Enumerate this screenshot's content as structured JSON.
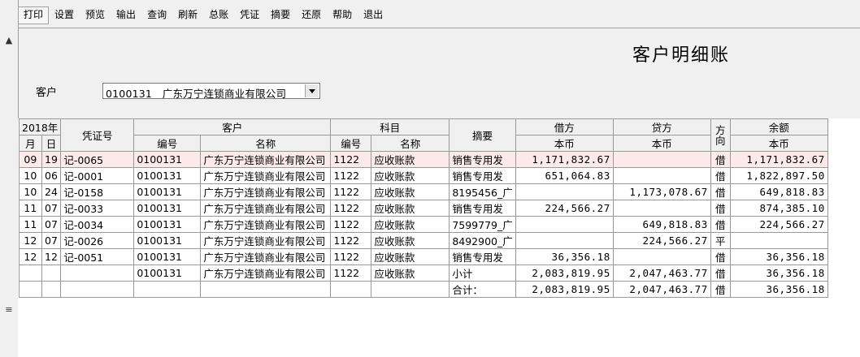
{
  "toolbar": [
    "打印",
    "设置",
    "预览",
    "输出",
    "查询",
    "刷新",
    "总账",
    "凭证",
    "摘要",
    "还原",
    "帮助",
    "退出"
  ],
  "title": "客户明细账",
  "filter": {
    "label": "客户",
    "value": "0100131　广东万宁连锁商业有限公司"
  },
  "header": {
    "year": "2018年",
    "month": "月",
    "day": "日",
    "voucher": "凭证号",
    "customer": "客户",
    "code": "编号",
    "name": "名称",
    "subject": "科目",
    "summary": "摘要",
    "debit": "借方",
    "credit": "贷方",
    "direction": "方向",
    "balance": "余额",
    "currency": "本币"
  },
  "rows": [
    {
      "m": "09",
      "d": "19",
      "v": "记-0065",
      "cc": "0100131",
      "cn": "广东万宁连锁商业有限公司",
      "sc": "1122",
      "sn": "应收账款",
      "s": "销售专用发",
      "dr": "1,171,832.67",
      "cr": "",
      "dir": "借",
      "bal": "1,171,832.67"
    },
    {
      "m": "10",
      "d": "06",
      "v": "记-0001",
      "cc": "0100131",
      "cn": "广东万宁连锁商业有限公司",
      "sc": "1122",
      "sn": "应收账款",
      "s": "销售专用发",
      "dr": "651,064.83",
      "cr": "",
      "dir": "借",
      "bal": "1,822,897.50"
    },
    {
      "m": "10",
      "d": "24",
      "v": "记-0158",
      "cc": "0100131",
      "cn": "广东万宁连锁商业有限公司",
      "sc": "1122",
      "sn": "应收账款",
      "s": "8195456_广",
      "dr": "",
      "cr": "1,173,078.67",
      "dir": "借",
      "bal": "649,818.83"
    },
    {
      "m": "11",
      "d": "07",
      "v": "记-0033",
      "cc": "0100131",
      "cn": "广东万宁连锁商业有限公司",
      "sc": "1122",
      "sn": "应收账款",
      "s": "销售专用发",
      "dr": "224,566.27",
      "cr": "",
      "dir": "借",
      "bal": "874,385.10"
    },
    {
      "m": "11",
      "d": "07",
      "v": "记-0034",
      "cc": "0100131",
      "cn": "广东万宁连锁商业有限公司",
      "sc": "1122",
      "sn": "应收账款",
      "s": "7599779_广",
      "dr": "",
      "cr": "649,818.83",
      "dir": "借",
      "bal": "224,566.27"
    },
    {
      "m": "12",
      "d": "07",
      "v": "记-0026",
      "cc": "0100131",
      "cn": "广东万宁连锁商业有限公司",
      "sc": "1122",
      "sn": "应收账款",
      "s": "8492900_广",
      "dr": "",
      "cr": "224,566.27",
      "dir": "平",
      "bal": ""
    },
    {
      "m": "12",
      "d": "12",
      "v": "记-0051",
      "cc": "0100131",
      "cn": "广东万宁连锁商业有限公司",
      "sc": "1122",
      "sn": "应收账款",
      "s": "销售专用发",
      "dr": "36,356.18",
      "cr": "",
      "dir": "借",
      "bal": "36,356.18"
    },
    {
      "m": "",
      "d": "",
      "v": "",
      "cc": "0100131",
      "cn": "广东万宁连锁商业有限公司",
      "sc": "1122",
      "sn": "应收账款",
      "s": "小计",
      "dr": "2,083,819.95",
      "cr": "2,047,463.77",
      "dir": "借",
      "bal": "36,356.18"
    },
    {
      "m": "",
      "d": "",
      "v": "",
      "cc": "",
      "cn": "",
      "sc": "",
      "sn": "",
      "s": "合计：",
      "dr": "2,083,819.95",
      "cr": "2,047,463.77",
      "dir": "借",
      "bal": "36,356.18"
    }
  ]
}
